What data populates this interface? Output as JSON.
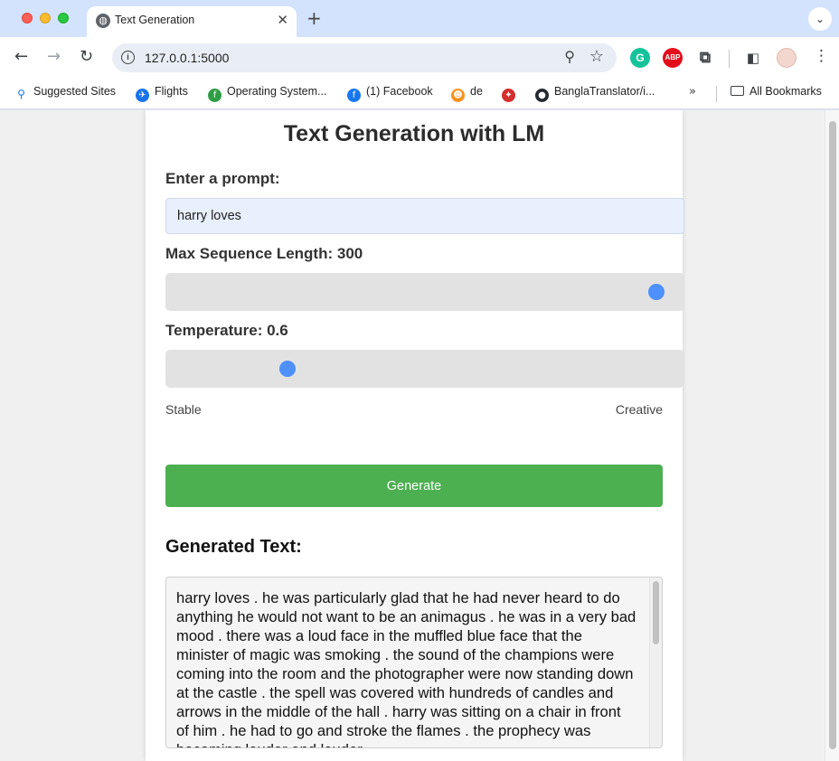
{
  "browser": {
    "tab_title": "Text Generation",
    "tab_icon": "globe-icon",
    "url": "127.0.0.1:5000",
    "bookmarks": [
      {
        "label": "Suggested Sites",
        "icon": "search-icon"
      },
      {
        "label": "Flights",
        "icon": "airplane-icon"
      },
      {
        "label": "Operating System...",
        "icon": "leaf-icon"
      },
      {
        "label": "(1) Facebook",
        "icon": "facebook-icon"
      },
      {
        "label": "de",
        "icon": "huggingface-icon"
      },
      {
        "label": "",
        "icon": "bird-icon"
      },
      {
        "label": "BanglaTranslator/i...",
        "icon": "github-icon"
      }
    ],
    "all_bookmarks_label": "All Bookmarks"
  },
  "page": {
    "title": "Text Generation with LM",
    "prompt_label": "Enter a prompt:",
    "prompt_value": "harry loves",
    "max_len_label": "Max Sequence Length: 300",
    "max_len_fraction": 0.97,
    "temperature_label": "Temperature: 0.6",
    "temperature_fraction": 0.22,
    "stable_label": "Stable",
    "creative_label": "Creative",
    "generate_label": "Generate",
    "output_heading": "Generated Text:",
    "output_text": "harry loves . he was particularly glad that he had never heard to do anything he would not want to be an animagus . he was in a very bad mood . there was a loud face in the muffled blue face that the minister of magic was smoking . the sound of the champions were coming into the room and the photographer were now standing down at the castle . the spell was covered with hundreds of candles and arrows in the middle of the hall . harry was sitting on a chair in front of him . he had to go and stroke the flames . the prophecy was becoming louder and louder"
  },
  "colors": {
    "generate_button": "#4caf50",
    "slider_thumb": "#4d90fe",
    "prompt_bg": "#e8f0fe"
  }
}
